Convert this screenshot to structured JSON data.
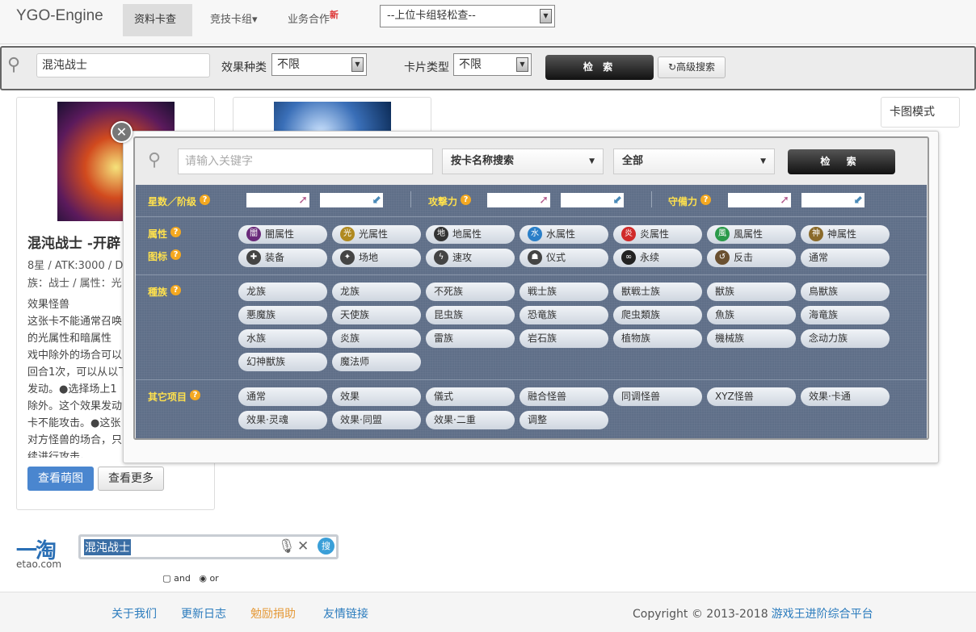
{
  "nav": {
    "brand": "YGO-Engine",
    "items": [
      "资料卡查",
      "竞技卡组▾",
      "业务合作"
    ],
    "new_badge": "新",
    "deck_select": "--上位卡组轻松查--"
  },
  "searchbar": {
    "query": "混沌战士",
    "effect_label": "效果种类",
    "effect_value": "不限",
    "type_label": "卡片类型",
    "type_value": "不限",
    "search_label": "检 索",
    "advanced_label": "高级搜索"
  },
  "view_mode": "卡图模式",
  "card": {
    "name": "混沌战士 -开辟",
    "stats_line1": "8星 / ATK:3000 / D",
    "stats_line2": "族：战士 / 属性：光",
    "text_lines": [
      "效果怪兽",
      "这张卡不能通常召唤",
      "的光属性和暗属性",
      "戏中除外的场合可以",
      "回合1次，可以从以下",
      "发动。●选择场上1",
      "除外。这个效果发动",
      "卡不能攻击。●这张",
      "对方怪兽的场合，只",
      "续进行攻击。"
    ],
    "btn_view": "查看萌图",
    "btn_more": "查看更多"
  },
  "advanced": {
    "keyword_placeholder": "请输入关键字",
    "mode_select": "按卡名称搜索",
    "scope_select": "全部",
    "search_label": "检 索",
    "level_label": "星数／阶级",
    "atk_label": "攻撃力",
    "def_label": "守備力",
    "attr_label": "属性",
    "icon_label": "图标",
    "race_label": "種族",
    "other_label": "其它项目",
    "help": "?",
    "attributes": [
      {
        "label": "闇属性",
        "glyph": "闇",
        "color": "#6a2a7a"
      },
      {
        "label": "光属性",
        "glyph": "光",
        "color": "#b08a20"
      },
      {
        "label": "地属性",
        "glyph": "地",
        "color": "#333333"
      },
      {
        "label": "水属性",
        "glyph": "水",
        "color": "#2a7fc8"
      },
      {
        "label": "炎属性",
        "glyph": "炎",
        "color": "#d02a2a"
      },
      {
        "label": "風属性",
        "glyph": "風",
        "color": "#2a9a4a"
      },
      {
        "label": "神属性",
        "glyph": "神",
        "color": "#8a6a2a"
      }
    ],
    "icons": [
      {
        "label": "装备",
        "glyph": "✚",
        "color": "#444444"
      },
      {
        "label": "场地",
        "glyph": "✦",
        "color": "#444444"
      },
      {
        "label": "速攻",
        "glyph": "ϟ",
        "color": "#444444"
      },
      {
        "label": "仪式",
        "glyph": "☗",
        "color": "#444444"
      },
      {
        "label": "永续",
        "glyph": "∞",
        "color": "#222222"
      },
      {
        "label": "反击",
        "glyph": "↺",
        "color": "#6a5030"
      },
      {
        "label": "通常",
        "glyph": "",
        "color": ""
      }
    ],
    "races": [
      "龙族",
      "龙族",
      "不死族",
      "戦士族",
      "獣戦士族",
      "獣族",
      "鳥獣族",
      "悪魔族",
      "天使族",
      "昆虫族",
      "恐竜族",
      "爬虫類族",
      "魚族",
      "海竜族",
      "水族",
      "炎族",
      "雷族",
      "岩石族",
      "植物族",
      "機械族",
      "念动力族",
      "幻神獣族",
      "魔法师"
    ],
    "others": [
      "通常",
      "效果",
      "儀式",
      "融合怪兽",
      "同调怪兽",
      "XYZ怪兽",
      "效果·卡通",
      "效果·灵魂",
      "效果·同盟",
      "效果·二重",
      "调整"
    ],
    "andor": {
      "and": "and",
      "or": "or"
    }
  },
  "etao": {
    "logo": "一淘",
    "sub": "etao.com",
    "query": "混沌战士",
    "go": "搜"
  },
  "footer": {
    "links": [
      "关于我们",
      "更新日志",
      "勉励捐助",
      "友情链接"
    ],
    "copyright": "Copyright © 2013-2018",
    "site": "游戏王进阶综合平台"
  }
}
